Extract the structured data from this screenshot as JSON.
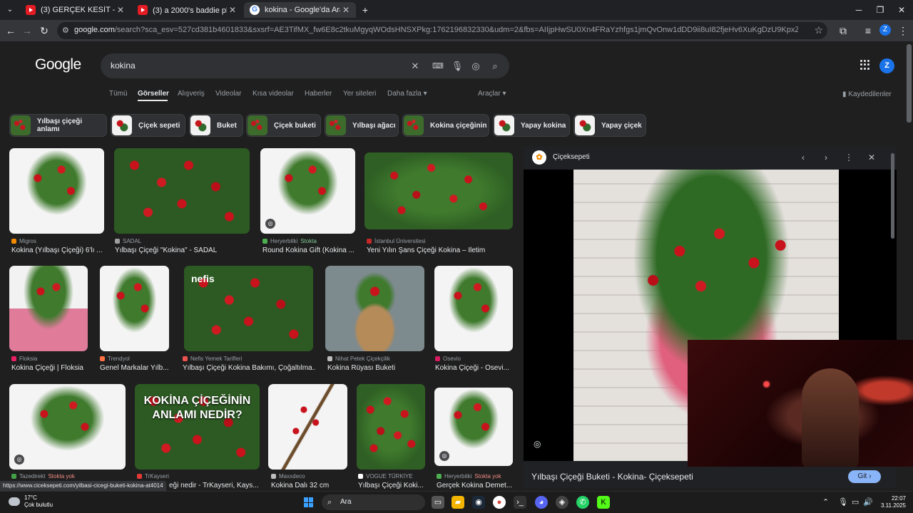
{
  "browser": {
    "tabs": [
      {
        "title": "(3) GERÇEK KESİT - SALINCAK -",
        "favicon": "youtube-icon",
        "active": false
      },
      {
        "title": "(3) a 2000's baddie playlist ★ y",
        "favicon": "youtube-icon",
        "active": false
      },
      {
        "title": "kokina - Google'da Ara",
        "favicon": "google-icon",
        "active": true
      }
    ],
    "new_tab": "+",
    "url_host": "google.com",
    "url_rest": "/search?sca_esv=527cd381b4601833&sxsrf=AE3TifMX_fw6E8c2tkuMgyqWOdsHNSXPkg:1762196832330&udm=2&fbs=AIIjpHwSU0Xn4FRaYzhfgs1jmQvOnw1dDD9ii8uI82fjeHv6XuKgDzU9KpxZMcpsjQNb1WcUrMDj8VH-V1nIlcqw5935G...",
    "profile_initial": "Z"
  },
  "google": {
    "logo": "Google",
    "query": "kokina",
    "profile_initial": "Z",
    "nav_tabs": [
      "Tümü",
      "Görseller",
      "Alışveriş",
      "Videolar",
      "Kısa videolar",
      "Haberler",
      "Yer siteleri",
      "Daha fazla ▾",
      "Araçlar ▾"
    ],
    "saved_label": "Kaydedilenler",
    "chips": [
      "Yılbaşı çiçeği anlamı",
      "Çiçek sepeti",
      "Buket",
      "Çiçek buketi",
      "Yılbaşı ağacı",
      "Kokina çiçeğinin",
      "Yapay kokina",
      "Yapay çiçek"
    ]
  },
  "results": [
    {
      "source": "Migros",
      "title": "Kokina (Yılbaşı Çiçeği) 6'lı ...",
      "stock": ""
    },
    {
      "source": "SADAL",
      "title": "Yılbaşı Çiçeği \"Kokina\" - SADAL",
      "stock": ""
    },
    {
      "source": "Heryerbitki",
      "title": "Round Kokina Gift (Kokina ...",
      "stock": "Stokta"
    },
    {
      "source": "İstanbul Üniversitesi",
      "title": "Yeni Yılın Şans Çiçeği Kokina – İletim",
      "stock": ""
    },
    {
      "source": "Floksia",
      "title": "Kokina Çiçeği | Floksia",
      "stock": ""
    },
    {
      "source": "Trendyol",
      "title": "Genel Markalar Yılb...",
      "stock": ""
    },
    {
      "source": "Nefis Yemek Tarifleri",
      "title": "Yılbaşı Çiçeği Kokina Bakımı, Çoğaltılma...",
      "stock": ""
    },
    {
      "source": "Nihat Petek Çiçekçilik",
      "title": "Kokina Rüyası Buketi",
      "stock": ""
    },
    {
      "source": "Osevio",
      "title": "Kokina Çiçeği - Osevi...",
      "stock": ""
    },
    {
      "source": "Tazedirekt",
      "title": "",
      "stock": "Stokta yok"
    },
    {
      "source": "TrKayseri",
      "title": "eği nedir - TrKayseri, Kays...",
      "stock": ""
    },
    {
      "source": "Maxxdeco",
      "title": "Kokina Dalı 32 cm",
      "stock": ""
    },
    {
      "source": "VOGUE TÜRKİYE",
      "title": "Yılbaşı Çiçeği Koki...",
      "stock": ""
    },
    {
      "source": "Heryerbitki",
      "title": "Gerçek Kokina Demet...",
      "stock": "Stokta yok"
    }
  ],
  "overlays": {
    "nefis_logo": "nefis",
    "kokina_text": "KOKİNA ÇİÇEĞİNİN ANLAMI NEDİR?"
  },
  "preview": {
    "site": "Çiçeksepeti",
    "title": "Yılbaşı Çiçeği Buketi - Kokina- Çiçeksepeti",
    "visit_label": "Git ›"
  },
  "status_url": "https://www.ciceksepeti.com/yilbasi-cicegi-buketi-kokina-at4014",
  "taskbar": {
    "temp": "17°C",
    "weather": "Çok bulutlu",
    "search_placeholder": "Ara",
    "time": "22:07",
    "date": "3.11.2025"
  },
  "colors": {
    "accent": "#8ab4f8",
    "stock_green": "#81c995",
    "stock_red": "#f28b82",
    "background": "#1f1f1f"
  }
}
